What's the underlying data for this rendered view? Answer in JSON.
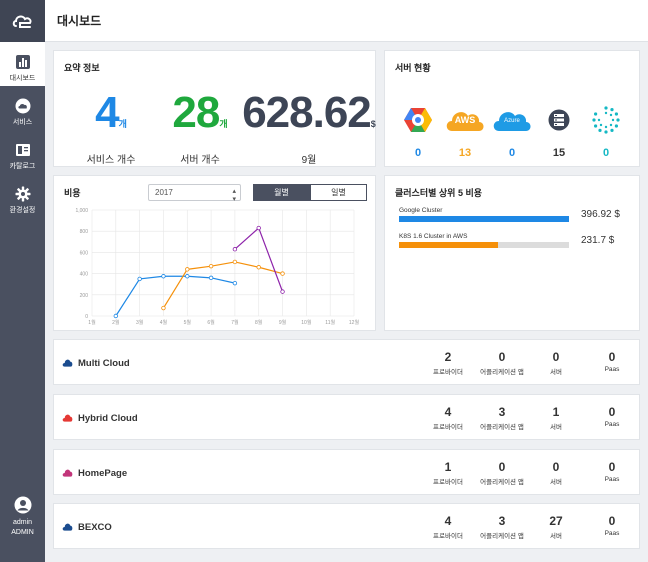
{
  "sidebar": {
    "items": [
      {
        "label": "대시보드",
        "icon": "bar-chart-icon",
        "active": true
      },
      {
        "label": "서비스",
        "icon": "cloud-icon"
      },
      {
        "label": "카탈로그",
        "icon": "catalog-icon"
      },
      {
        "label": "환경설정",
        "icon": "gear-icon"
      }
    ],
    "user": {
      "name": "admin",
      "role": "ADMIN"
    }
  },
  "header": {
    "title": "대시보드"
  },
  "summary": {
    "title": "요약 정보",
    "services": {
      "value": "4",
      "unit": "개",
      "label": "서비스 개수",
      "color": "#1e88e5"
    },
    "servers": {
      "value": "28",
      "unit": "개",
      "label": "서버 개수",
      "color": "#1fa83d"
    },
    "cost": {
      "value": "628.62",
      "unit": "$",
      "label": "9월",
      "color": "#3d4556"
    }
  },
  "server_status": {
    "title": "서버 현황",
    "items": [
      {
        "name": "google-cloud-icon",
        "count": "0",
        "color": "#1e88e5"
      },
      {
        "name": "aws-icon",
        "label": "AWS",
        "count": "13",
        "color": "#f5a623"
      },
      {
        "name": "azure-icon",
        "label": "Azure",
        "count": "0",
        "color": "#1e88e5"
      },
      {
        "name": "server-rack-icon",
        "count": "15",
        "color": "#333333"
      },
      {
        "name": "openstack-icon",
        "count": "0",
        "color": "#14b8c4"
      }
    ]
  },
  "cost": {
    "title": "비용",
    "year_select": "2017",
    "toggle_monthly": "월별",
    "toggle_daily": "일별"
  },
  "chart_data": {
    "type": "line",
    "categories": [
      "1월",
      "2월",
      "3월",
      "4월",
      "5월",
      "6월",
      "7월",
      "8월",
      "9월",
      "10월",
      "11월",
      "12월"
    ],
    "ylim": [
      0,
      1000
    ],
    "yticks": [
      "0",
      "200",
      "400",
      "600",
      "800",
      "1,000"
    ],
    "grid": true,
    "series": [
      {
        "color": "#1e88e5",
        "values": [
          null,
          0,
          350,
          375,
          375,
          360,
          310,
          null,
          null,
          null,
          null,
          null
        ]
      },
      {
        "color": "#f5900a",
        "values": [
          null,
          null,
          null,
          75,
          440,
          470,
          510,
          460,
          400,
          null,
          null,
          null
        ]
      },
      {
        "color": "#8e24aa",
        "values": [
          null,
          null,
          null,
          null,
          null,
          null,
          630,
          830,
          230,
          null,
          null,
          null
        ]
      }
    ]
  },
  "top5": {
    "title": "클러스터별 상위 5 비용",
    "items": [
      {
        "name": "Google Cluster",
        "value": "396.92 $",
        "fraction": 1.0,
        "color": "#1e88e5"
      },
      {
        "name": "K8S 1.6 Cluster in AWS",
        "value": "231.7 $",
        "fraction": 0.58,
        "color": "#f5900a"
      }
    ]
  },
  "stat_labels": {
    "provider": "프로바이더",
    "apps": "어플리케이션 앱",
    "server": "서버",
    "paas": "Paas"
  },
  "projects": [
    {
      "name": "Multi Cloud",
      "color": "#1b4c8f",
      "provider": "2",
      "apps": "0",
      "server": "0",
      "paas": "0"
    },
    {
      "name": "Hybrid Cloud",
      "color": "#e53935",
      "provider": "4",
      "apps": "3",
      "server": "1",
      "paas": "0"
    },
    {
      "name": "HomePage",
      "color": "#c2357a",
      "provider": "1",
      "apps": "0",
      "server": "0",
      "paas": "0"
    },
    {
      "name": "BEXCO",
      "color": "#1b4c8f",
      "provider": "4",
      "apps": "3",
      "server": "27",
      "paas": "0"
    }
  ]
}
